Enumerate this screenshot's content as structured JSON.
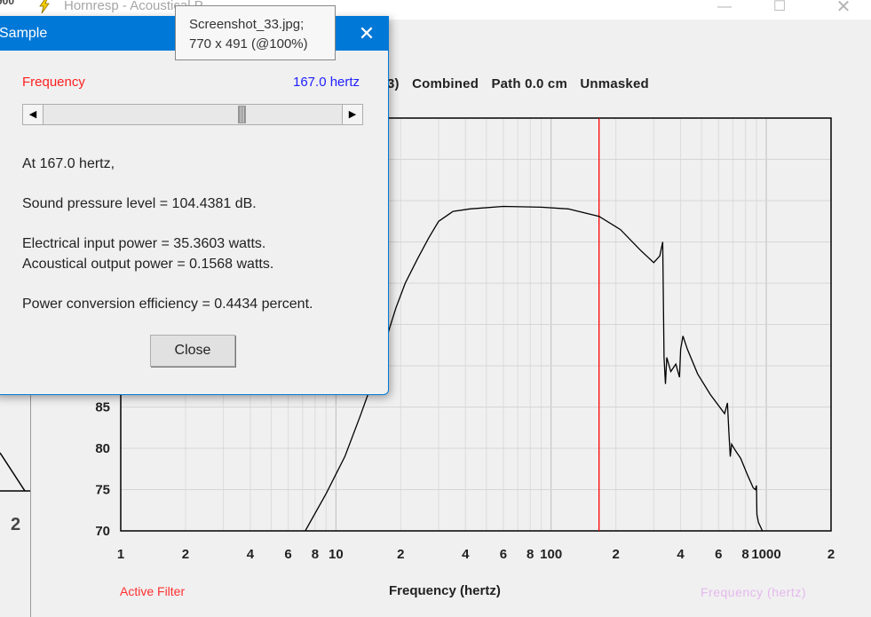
{
  "main_window": {
    "title": "Hornresp - Acoustical P",
    "left_edge_digits": "900",
    "minimize_glyph": "—",
    "maximize_glyph": "☐",
    "close_glyph": "✕",
    "left_panel_number": "2"
  },
  "graph": {
    "header": [
      "3)",
      "Combined",
      "Path 0.0 cm",
      "Unmasked"
    ],
    "y_tick_labels": [
      "85",
      "80",
      "75",
      "70"
    ],
    "x_tick_labels": [
      "1",
      "2",
      "4",
      "6",
      "8",
      "10",
      "2",
      "4",
      "6",
      "8",
      "100",
      "2",
      "4",
      "6",
      "8",
      "1000",
      "2"
    ],
    "x_axis_title": "Frequency (hertz)",
    "active_filter_label": "Active Filter",
    "ghost_label": "Frequency (hertz)",
    "marker_frequency_hz": 167.0,
    "marker_color": "#ff0000",
    "trace_color": "#000000",
    "x_scale": "log",
    "x_range_hz": [
      1,
      2000
    ],
    "y_range_db": [
      70,
      120
    ],
    "grid": true
  },
  "chart_data": {
    "type": "line",
    "x_scale": "log",
    "xlabel": "Frequency (hertz)",
    "ylabel": "",
    "xlim": [
      1,
      2000
    ],
    "ylim": [
      70,
      120
    ],
    "series": [
      {
        "values_xy": [
          [
            7.2,
            70
          ],
          [
            9,
            74.5
          ],
          [
            11,
            79
          ],
          [
            13,
            84
          ],
          [
            15,
            88.5
          ],
          [
            17,
            93
          ],
          [
            19,
            97
          ],
          [
            21,
            100
          ],
          [
            24,
            103
          ],
          [
            27,
            105.5
          ],
          [
            30,
            107.5
          ],
          [
            35,
            108.7
          ],
          [
            42,
            109
          ],
          [
            60,
            109.3
          ],
          [
            90,
            109.2
          ],
          [
            120,
            109
          ],
          [
            167,
            108.1
          ],
          [
            210,
            106.5
          ],
          [
            260,
            104
          ],
          [
            300,
            102.5
          ],
          [
            320,
            103.3
          ],
          [
            330,
            105
          ],
          [
            335,
            91
          ],
          [
            340,
            87.8
          ],
          [
            345,
            91
          ],
          [
            360,
            89.3
          ],
          [
            380,
            90.2
          ],
          [
            395,
            88.6
          ],
          [
            400,
            92
          ],
          [
            410,
            93.6
          ],
          [
            430,
            92
          ],
          [
            480,
            89
          ],
          [
            550,
            86.5
          ],
          [
            640,
            84.2
          ],
          [
            660,
            85.5
          ],
          [
            670,
            82
          ],
          [
            680,
            79
          ],
          [
            690,
            80.5
          ],
          [
            720,
            79.7
          ],
          [
            760,
            78.8
          ],
          [
            820,
            76.7
          ],
          [
            870,
            75.2
          ],
          [
            890,
            75
          ],
          [
            900,
            75.5
          ],
          [
            905,
            72
          ],
          [
            920,
            71
          ],
          [
            960,
            70
          ]
        ]
      }
    ],
    "marker_x": 167
  },
  "tooltip": {
    "line1": "Screenshot_33.jpg;",
    "line2": "770 x 491 (@100%)"
  },
  "dialog": {
    "title": "Sample",
    "close_glyph": "✕",
    "frequency_label": "Frequency",
    "frequency_value": "167.0 hertz",
    "slider_left_glyph": "◀",
    "slider_right_glyph": "▶",
    "slider_fraction": 0.67,
    "at_text": "At 167.0 hertz,",
    "spl_text": "Sound pressure level = 104.4381 dB.",
    "electrical_text": "Electrical input power = 35.3603 watts.",
    "acoustical_text": "Acoustical output power = 0.1568 watts.",
    "efficiency_text": "Power conversion efficiency = 0.4434 percent.",
    "close_button_label": "Close"
  }
}
